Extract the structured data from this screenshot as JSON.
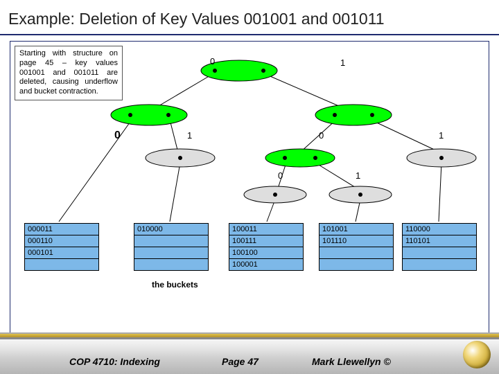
{
  "title": "Example: Deletion of Key Values 001001 and 001011",
  "note": "Starting with structure on page 45 – key values 001001 and 001011 are deleted, causing underflow and bucket contraction.",
  "tree": {
    "root": {
      "left": "0",
      "right": "1"
    },
    "level2_left": {
      "l": "0",
      "r": "1"
    },
    "level2_right": {
      "l": "0",
      "r": "1"
    },
    "level3_right": {
      "l": "0",
      "r": "1"
    }
  },
  "buckets": [
    {
      "id": "b0",
      "slots": [
        "000011",
        "000110",
        "000101",
        ""
      ]
    },
    {
      "id": "b1",
      "slots": [
        "010000",
        "",
        "",
        ""
      ]
    },
    {
      "id": "b2",
      "slots": [
        "100011",
        "100111",
        "100100",
        "100001"
      ]
    },
    {
      "id": "b3",
      "slots": [
        "101001",
        "101110",
        "",
        ""
      ]
    },
    {
      "id": "b4",
      "slots": [
        "110000",
        "110101",
        "",
        ""
      ]
    }
  ],
  "buckets_label": "the buckets",
  "footer": {
    "course": "COP 4710: Indexing",
    "page": "Page 47",
    "author": "Mark Llewellyn ©"
  }
}
